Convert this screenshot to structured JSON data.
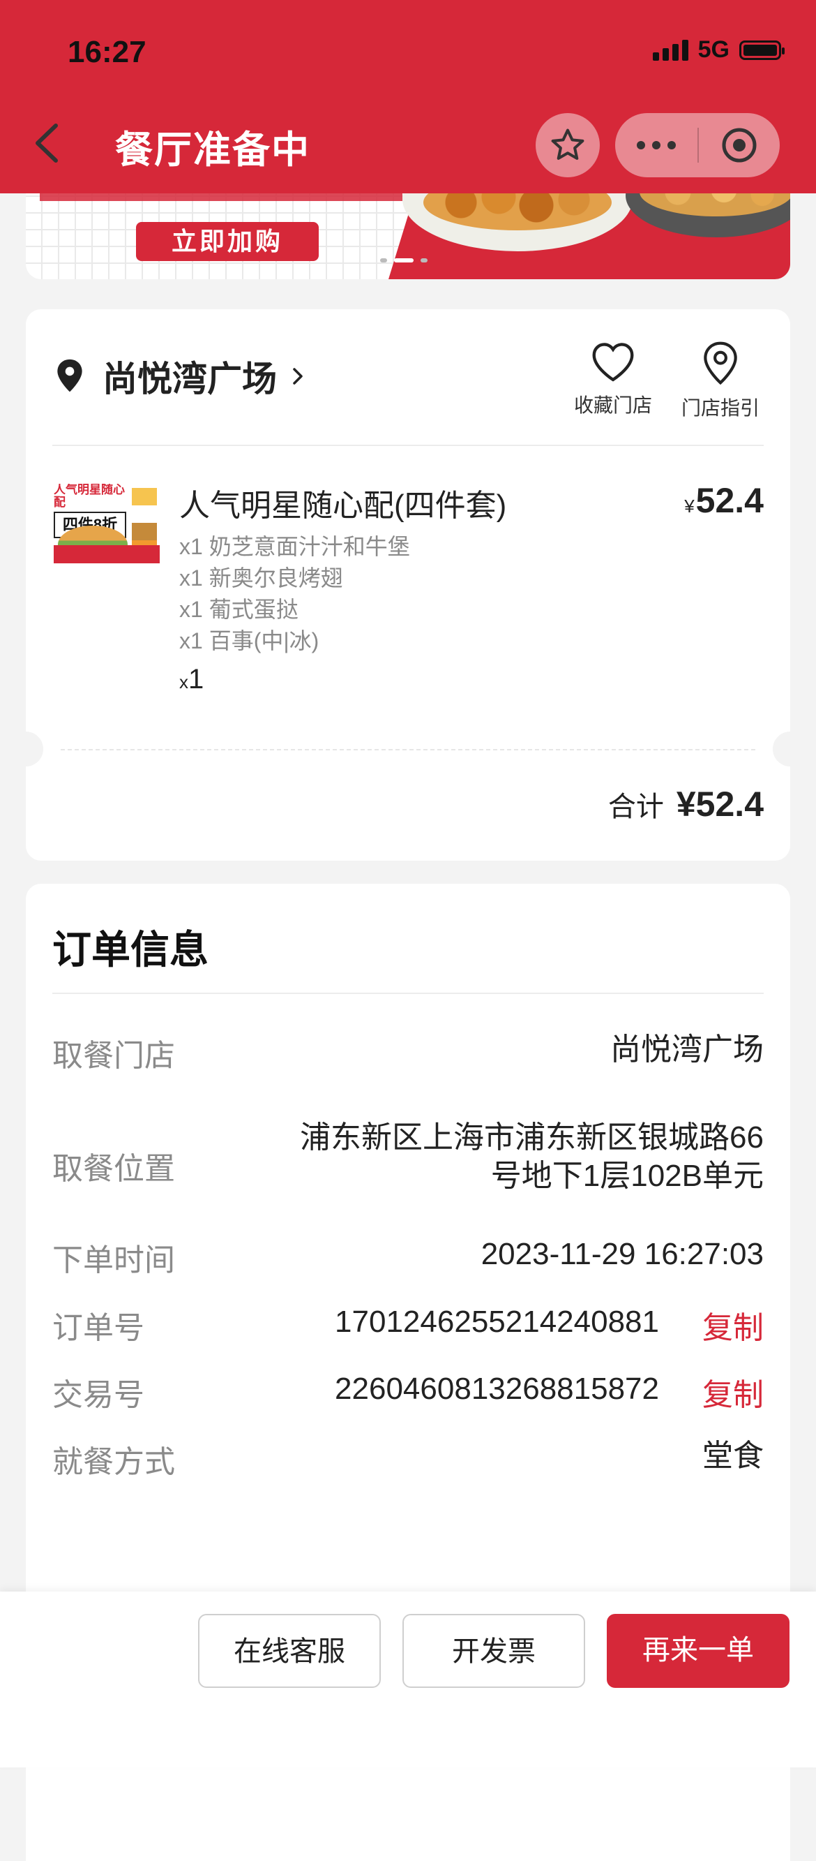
{
  "status_bar": {
    "time": "16:27",
    "network": "5G"
  },
  "header": {
    "title": "餐厅准备中"
  },
  "banner": {
    "button_label": "立即加购"
  },
  "store": {
    "name": "尚悦湾广场",
    "actions": [
      {
        "label": "收藏门店",
        "icon": "heart-icon"
      },
      {
        "label": "门店指引",
        "icon": "map-pin-icon"
      }
    ]
  },
  "item": {
    "image_text_top": "人气明星随心配",
    "image_text_tag": "四件8折",
    "name": "人气明星随心配(四件套)",
    "currency": "¥",
    "price": "52.4",
    "sub_items": [
      "x1 奶芝意面汁汁和牛堡",
      "x1 新奥尔良烤翅",
      "x1 葡式蛋挞",
      "x1 百事(中|冰)"
    ],
    "qty_prefix": "x",
    "qty": "1"
  },
  "total": {
    "label": "合计",
    "amount": "¥52.4"
  },
  "order_info": {
    "title": "订单信息",
    "rows": [
      {
        "label": "取餐门店",
        "value": "尚悦湾广场"
      },
      {
        "label": "取餐位置",
        "value_line1": "浦东新区上海市浦东新区银城路66",
        "value_line2": "号地下1层102B单元"
      },
      {
        "label": "下单时间",
        "value": "2023-11-29 16:27:03"
      },
      {
        "label": "订单号",
        "value": "1701246255214240881",
        "action": "复制"
      },
      {
        "label": "交易号",
        "value": "2260460813268815872",
        "action": "复制"
      },
      {
        "label": "就餐方式",
        "value": "堂食"
      }
    ]
  },
  "bottom_bar": {
    "customer_service": "在线客服",
    "invoice": "开发票",
    "reorder": "再来一单"
  },
  "colors": {
    "brand_red": "#d62839",
    "muted_text": "#8a8a8a"
  }
}
